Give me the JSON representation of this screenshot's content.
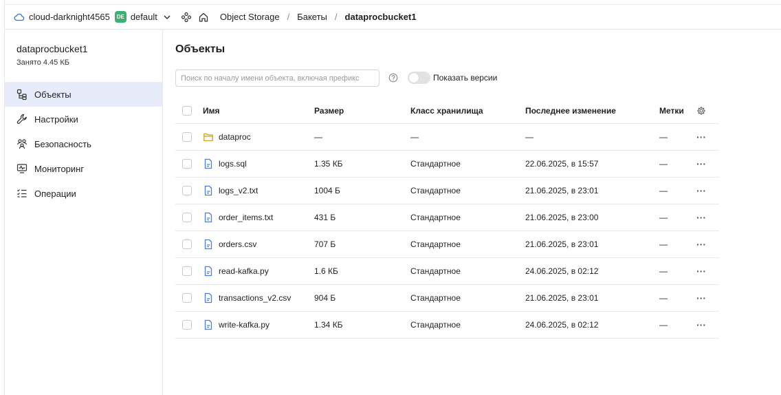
{
  "header": {
    "cloud_name": "cloud-darknight4565",
    "folder_badge": "DE",
    "folder_name": "default",
    "breadcrumb": [
      "Object Storage",
      "Бакеты",
      "dataprocbucket1"
    ],
    "separator": "/"
  },
  "sidebar": {
    "bucket_name": "dataprocbucket1",
    "bucket_size": "Занято 4.45 КБ",
    "items": [
      {
        "label": "Объекты",
        "icon": "objects-icon",
        "active": true
      },
      {
        "label": "Настройки",
        "icon": "wrench-icon"
      },
      {
        "label": "Безопасность",
        "icon": "people-icon"
      },
      {
        "label": "Мониторинг",
        "icon": "monitor-icon"
      },
      {
        "label": "Операции",
        "icon": "list-icon"
      }
    ]
  },
  "main": {
    "title": "Объекты",
    "search_placeholder": "Поиск по началу имени объекта, включая префикс",
    "toggle_label": "Показать версии",
    "columns": [
      "Имя",
      "Размер",
      "Класс хранилища",
      "Последнее изменение",
      "Метки"
    ],
    "rows": [
      {
        "name": "dataproc",
        "type": "folder",
        "size": "—",
        "class": "—",
        "date": "—",
        "tags": "—"
      },
      {
        "name": "logs.sql",
        "type": "file",
        "size": "1.35 КБ",
        "class": "Стандартное",
        "date": "22.06.2025, в 15:57",
        "tags": "—"
      },
      {
        "name": "logs_v2.txt",
        "type": "file",
        "size": "1004 Б",
        "class": "Стандартное",
        "date": "21.06.2025, в 23:01",
        "tags": "—"
      },
      {
        "name": "order_items.txt",
        "type": "file",
        "size": "431 Б",
        "class": "Стандартное",
        "date": "21.06.2025, в 23:00",
        "tags": "—"
      },
      {
        "name": "orders.csv",
        "type": "file",
        "size": "707 Б",
        "class": "Стандартное",
        "date": "21.06.2025, в 23:01",
        "tags": "—"
      },
      {
        "name": "read-kafka.py",
        "type": "file",
        "size": "1.6 КБ",
        "class": "Стандартное",
        "date": "24.06.2025, в 02:12",
        "tags": "—"
      },
      {
        "name": "transactions_v2.csv",
        "type": "file",
        "size": "904 Б",
        "class": "Стандартное",
        "date": "21.06.2025, в 23:01",
        "tags": "—"
      },
      {
        "name": "write-kafka.py",
        "type": "file",
        "size": "1.34 КБ",
        "class": "Стандартное",
        "date": "24.06.2025, в 02:12",
        "tags": "—"
      }
    ],
    "actions_glyph": "···"
  },
  "colors": {
    "active_nav_bg": "#e8ecfa",
    "folder_badge": "#3bb071",
    "folder_icon": "#c9a227",
    "file_icon": "#4a7fd6"
  }
}
